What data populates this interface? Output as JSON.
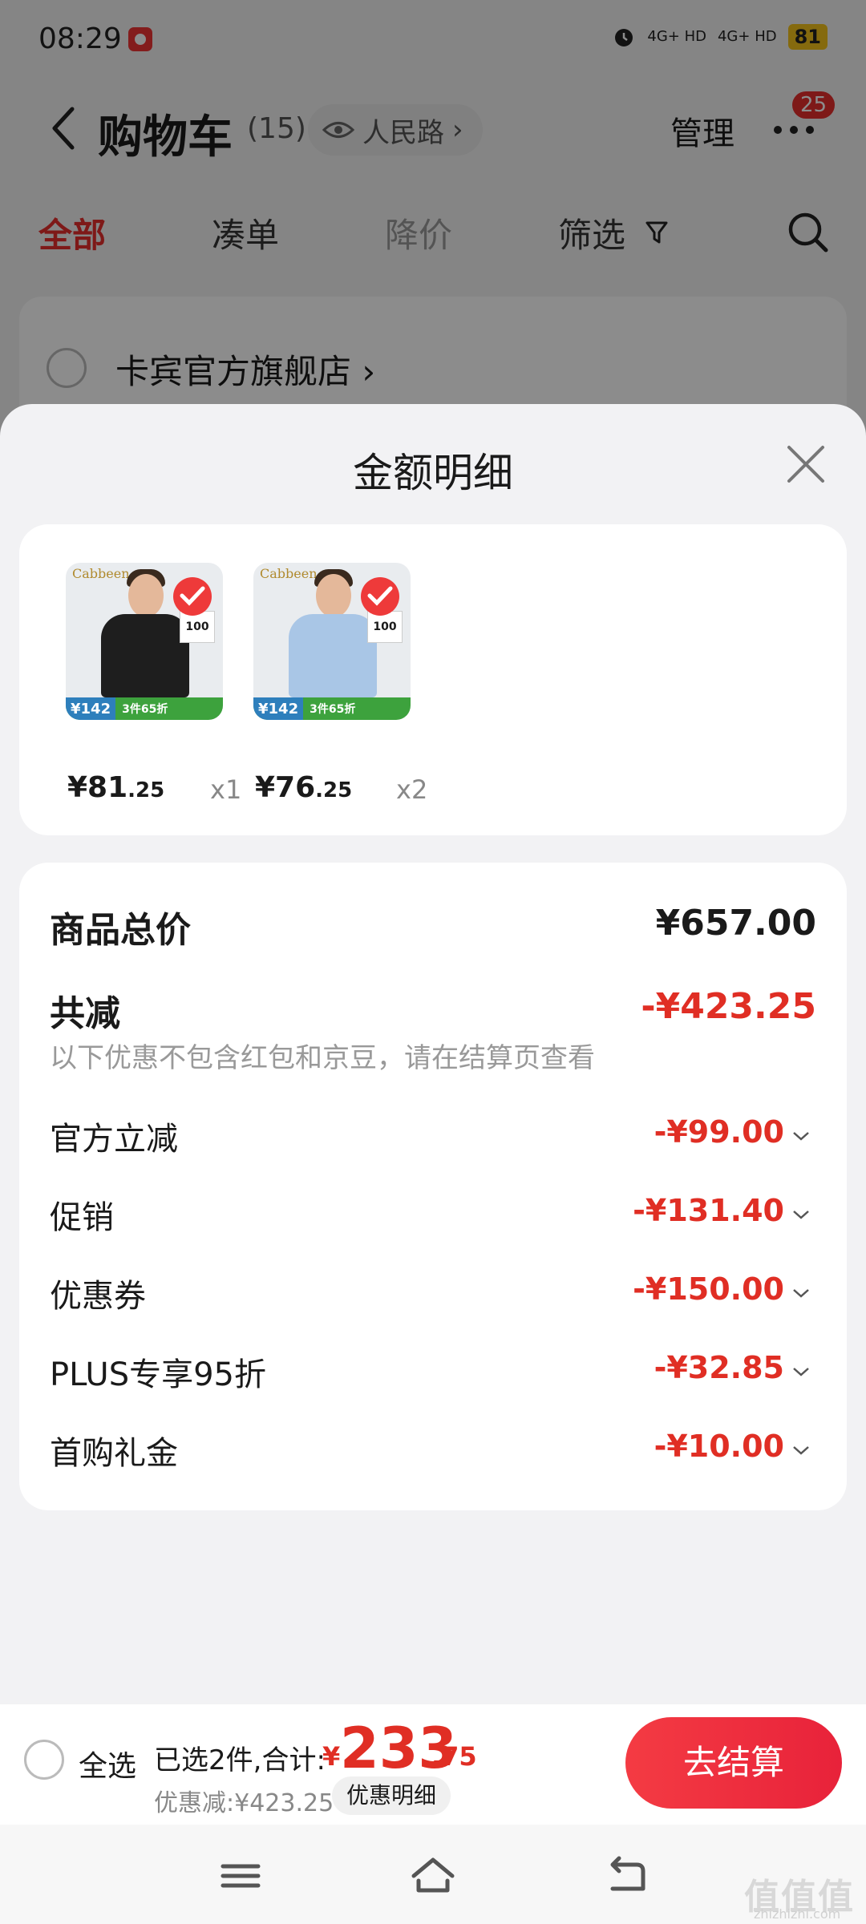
{
  "status_bar": {
    "time": "08:29",
    "signal1": "4G+ HD",
    "signal2": "4G+ HD",
    "battery": "81"
  },
  "nav": {
    "title": "购物车",
    "count": "(15)",
    "location": "人民路",
    "location_arrow": "›",
    "manage": "管理",
    "badge": "25"
  },
  "tabs": [
    {
      "label": "全部"
    },
    {
      "label": "凑单"
    },
    {
      "label": "降价"
    },
    {
      "label": "筛选"
    }
  ],
  "store": {
    "name": "卡宾官方旗舰店 ›"
  },
  "sheet": {
    "title": "金额明细",
    "products": [
      {
        "price_int": "¥81",
        "price_dec": ".25",
        "qty": "x1",
        "strip_left": "¥142",
        "strip_right": "3件65折",
        "side": "100",
        "logo": "Cabbeen",
        "shirt_color": "#1e1e1e"
      },
      {
        "price_int": "¥76",
        "price_dec": ".25",
        "qty": "x2",
        "strip_left": "¥142",
        "strip_right": "3件65折",
        "side": "100",
        "logo": "Cabbeen",
        "shirt_color": "#a9c6e6"
      }
    ],
    "total_label": "商品总价",
    "total_value": "¥657.00",
    "reduce_label": "共减",
    "reduce_value": "-¥423.25",
    "reduce_note": "以下优惠不包含红包和京豆，请在结算页查看",
    "discounts": [
      {
        "label": "官方立减",
        "value": "-¥99.00"
      },
      {
        "label": "促销",
        "value": "-¥131.40"
      },
      {
        "label": "优惠券",
        "value": "-¥150.00"
      },
      {
        "label": "PLUS专享95折",
        "value": "-¥32.85"
      },
      {
        "label": "首购礼金",
        "value": "-¥10.00"
      }
    ]
  },
  "bottom": {
    "select_all": "全选",
    "selected": "已选2件,合计:",
    "currency": "¥",
    "total_int": "233",
    "total_dec": ".75",
    "saved": "优惠减:¥423.25",
    "detail_btn": "优惠明细",
    "checkout": "去结算"
  },
  "watermark": {
    "main": "值值值",
    "sub": "zhizhizhi.com"
  },
  "colors": {
    "accent": "#e02e24",
    "checkout": "#f43b43"
  }
}
